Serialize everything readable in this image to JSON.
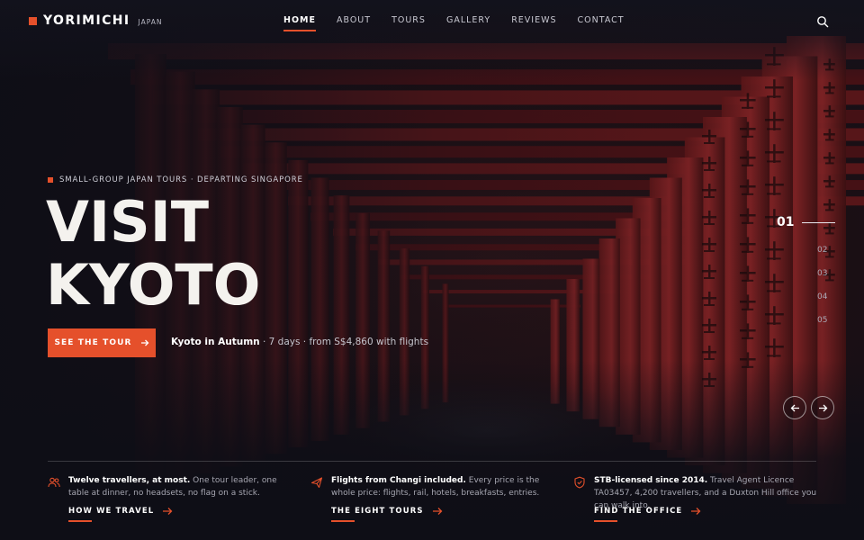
{
  "brand": {
    "name": "YORIMICHI",
    "tag": "JAPAN",
    "accent": "#e5502b"
  },
  "nav": {
    "items": [
      {
        "label": "HOME",
        "active": true
      },
      {
        "label": "ABOUT",
        "active": false
      },
      {
        "label": "TOURS",
        "active": false
      },
      {
        "label": "GALLERY",
        "active": false
      },
      {
        "label": "REVIEWS",
        "active": false
      },
      {
        "label": "CONTACT",
        "active": false
      }
    ],
    "search_icon": "search-icon"
  },
  "hero": {
    "eyebrow": "SMALL-GROUP JAPAN TOURS · DEPARTING SINGAPORE",
    "title_line1": "VISIT",
    "title_line2": "KYOTO",
    "cta_label": "SEE THE TOUR",
    "tour_name": "Kyoto in Autumn",
    "tour_details": " · 7 days · from S$4,860 with flights"
  },
  "slider": {
    "current": "01",
    "others": [
      "02",
      "03",
      "04",
      "05"
    ],
    "prev_icon": "arrow-left-icon",
    "next_icon": "arrow-right-icon"
  },
  "features": [
    {
      "icon": "users-icon",
      "bold": "Twelve travellers, at most.",
      "text": " One tour leader, one table at dinner, no headsets, no flag on a stick.",
      "link": "HOW WE TRAVEL"
    },
    {
      "icon": "plane-icon",
      "bold": "Flights from Changi included.",
      "text": " Every price is the whole price: flights, rail, hotels, breakfasts, entries.",
      "link": "THE EIGHT TOURS"
    },
    {
      "icon": "shield-icon",
      "bold": "STB-licensed since 2014.",
      "text": " Travel Agent Licence TA03457, 4,200 travellers, and a Duxton Hill office you can walk into.",
      "link": "FIND THE OFFICE"
    }
  ]
}
